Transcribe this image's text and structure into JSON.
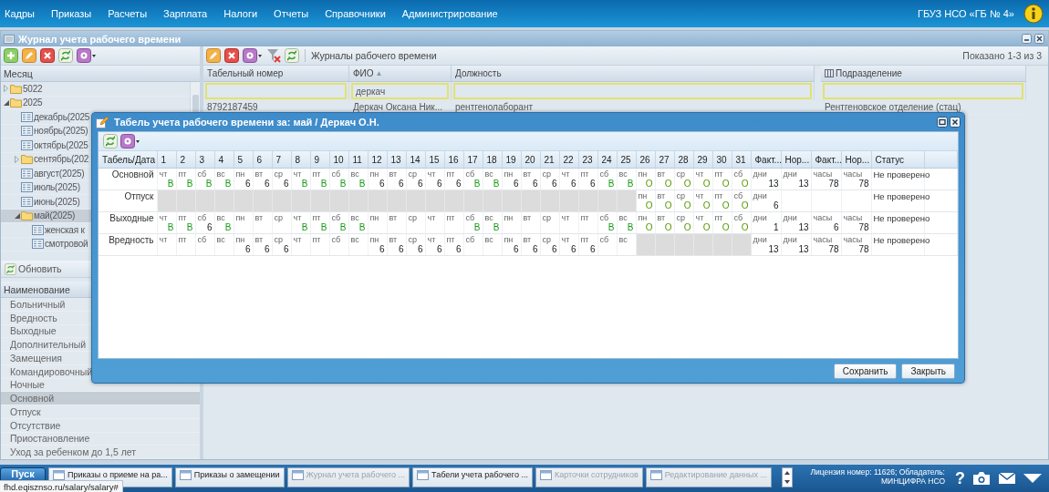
{
  "menu": {
    "items": [
      "Кадры",
      "Приказы",
      "Расчеты",
      "Зарплата",
      "Налоги",
      "Отчеты",
      "Справочники",
      "Администрирование"
    ],
    "organization": "ГБУЗ НСО «ГБ № 4»"
  },
  "journal": {
    "title": "Журнал учета рабочего времени",
    "month_tree": {
      "header": "Месяц",
      "items": [
        {
          "label": "5022",
          "kind": "folder",
          "expanded": false,
          "selected": false
        },
        {
          "label": "2025",
          "kind": "folder",
          "expanded": true,
          "selected": false,
          "children": [
            {
              "label": "декабрь(2025",
              "kind": "leaf",
              "selected": false
            },
            {
              "label": "ноябрь(2025)",
              "kind": "leaf",
              "selected": false
            },
            {
              "label": "октябрь(2025",
              "kind": "leaf",
              "selected": false
            },
            {
              "label": "сентябрь(202",
              "kind": "folder",
              "expanded": false,
              "selected": false
            },
            {
              "label": "август(2025)",
              "kind": "leaf",
              "selected": false
            },
            {
              "label": "июль(2025)",
              "kind": "leaf",
              "selected": false
            },
            {
              "label": "июнь(2025)",
              "kind": "leaf",
              "selected": false
            },
            {
              "label": "май(2025)",
              "kind": "folder",
              "expanded": true,
              "selected": true,
              "children": [
                {
                  "label": "женская к",
                  "kind": "leaf",
                  "selected": false
                },
                {
                  "label": "смотровой",
                  "kind": "leaf",
                  "selected": false
                }
              ]
            }
          ]
        }
      ]
    },
    "refresh_button": "Обновить",
    "types": {
      "header": "Наименование",
      "items": [
        {
          "label": "Больничный",
          "selected": false
        },
        {
          "label": "Вредность",
          "selected": false
        },
        {
          "label": "Выходные",
          "selected": false
        },
        {
          "label": "Дополнительный",
          "selected": false
        },
        {
          "label": "Замещения",
          "selected": false
        },
        {
          "label": "Командировочный",
          "selected": false
        },
        {
          "label": "Ночные",
          "selected": false
        },
        {
          "label": "Основной",
          "selected": true
        },
        {
          "label": "Отпуск",
          "selected": false
        },
        {
          "label": "Отсутствие",
          "selected": false
        },
        {
          "label": "Приостановление",
          "selected": false
        },
        {
          "label": "Уход за ребенком до 1,5 лет",
          "selected": false
        }
      ]
    },
    "grid": {
      "toolbar_title": "Журналы рабочего времени",
      "paging": "Показано 1-3 из 3",
      "columns": [
        {
          "label": "Табельный номер"
        },
        {
          "label": "ФИО",
          "sort_arrow": "▲",
          "filter": "деркач"
        },
        {
          "label": "Должность"
        },
        {
          "label": "Подразделение"
        }
      ],
      "rows": [
        {
          "cells": [
            "8792187459",
            "Деркач Оксана Ник...",
            "рентгенолаборант",
            "Рентгеновское отделение (стац)"
          ],
          "selected": false
        }
      ]
    }
  },
  "dialog": {
    "title": "Табель учета рабочего времени за: май / Деркач О.Н.",
    "columns": {
      "label": "Табель/Дата",
      "days": [
        "1",
        "2",
        "3",
        "4",
        "5",
        "6",
        "7",
        "8",
        "9",
        "10",
        "11",
        "12",
        "13",
        "14",
        "15",
        "16",
        "17",
        "18",
        "19",
        "20",
        "21",
        "22",
        "23",
        "24",
        "25",
        "26",
        "27",
        "28",
        "29",
        "30",
        "31"
      ],
      "totals": [
        "Факт...",
        "Нор...",
        "Факт...",
        "Нор..."
      ],
      "status": "Статус"
    },
    "rows": [
      {
        "label": "Основной",
        "days": [
          {
            "weekday": "чт",
            "kind": "off",
            "value": "В"
          },
          {
            "weekday": "пт",
            "kind": "off",
            "value": "В"
          },
          {
            "weekday": "сб",
            "kind": "off",
            "value": "В"
          },
          {
            "weekday": "вс",
            "kind": "off",
            "value": "В"
          },
          {
            "weekday": "пн",
            "kind": "hours",
            "value": "6"
          },
          {
            "weekday": "вт",
            "kind": "hours",
            "value": "6"
          },
          {
            "weekday": "ср",
            "kind": "hours",
            "value": "6"
          },
          {
            "weekday": "чт",
            "kind": "off",
            "value": "В"
          },
          {
            "weekday": "пт",
            "kind": "off",
            "value": "В"
          },
          {
            "weekday": "сб",
            "kind": "off",
            "value": "В"
          },
          {
            "weekday": "вс",
            "kind": "off",
            "value": "В"
          },
          {
            "weekday": "пн",
            "kind": "hours",
            "value": "6"
          },
          {
            "weekday": "вт",
            "kind": "hours",
            "value": "6"
          },
          {
            "weekday": "ср",
            "kind": "hours",
            "value": "6"
          },
          {
            "weekday": "чт",
            "kind": "hours",
            "value": "6"
          },
          {
            "weekday": "пт",
            "kind": "hours",
            "value": "6"
          },
          {
            "weekday": "сб",
            "kind": "off",
            "value": "В"
          },
          {
            "weekday": "вс",
            "kind": "off",
            "value": "В"
          },
          {
            "weekday": "пн",
            "kind": "hours",
            "value": "6"
          },
          {
            "weekday": "вт",
            "kind": "hours",
            "value": "6"
          },
          {
            "weekday": "ср",
            "kind": "hours",
            "value": "6"
          },
          {
            "weekday": "чт",
            "kind": "hours",
            "value": "6"
          },
          {
            "weekday": "пт",
            "kind": "hours",
            "value": "6"
          },
          {
            "weekday": "сб",
            "kind": "off",
            "value": "В"
          },
          {
            "weekday": "вс",
            "kind": "off",
            "value": "В"
          },
          {
            "weekday": "пн",
            "kind": "leave",
            "value": "О"
          },
          {
            "weekday": "вт",
            "kind": "leave",
            "value": "О"
          },
          {
            "weekday": "ср",
            "kind": "leave",
            "value": "О"
          },
          {
            "weekday": "чт",
            "kind": "leave",
            "value": "О"
          },
          {
            "weekday": "пт",
            "kind": "leave",
            "value": "О"
          },
          {
            "weekday": "сб",
            "kind": "leave",
            "value": "О"
          }
        ],
        "totals": [
          {
            "unit": "дни",
            "value": "13"
          },
          {
            "unit": "дни",
            "value": "13"
          },
          {
            "unit": "часы",
            "value": "78"
          },
          {
            "unit": "часы",
            "value": "78"
          }
        ],
        "status": "Не проверено"
      },
      {
        "label": "Отпуск",
        "days": [
          {
            "kind": "disabled"
          },
          {
            "kind": "disabled"
          },
          {
            "kind": "disabled"
          },
          {
            "kind": "disabled"
          },
          {
            "kind": "disabled"
          },
          {
            "kind": "disabled"
          },
          {
            "kind": "disabled"
          },
          {
            "kind": "disabled"
          },
          {
            "kind": "disabled"
          },
          {
            "kind": "disabled"
          },
          {
            "kind": "disabled"
          },
          {
            "kind": "disabled"
          },
          {
            "kind": "disabled"
          },
          {
            "kind": "disabled"
          },
          {
            "kind": "disabled"
          },
          {
            "kind": "disabled"
          },
          {
            "kind": "disabled"
          },
          {
            "kind": "disabled"
          },
          {
            "kind": "disabled"
          },
          {
            "kind": "disabled"
          },
          {
            "kind": "disabled"
          },
          {
            "kind": "disabled"
          },
          {
            "kind": "disabled"
          },
          {
            "kind": "disabled"
          },
          {
            "kind": "disabled"
          },
          {
            "weekday": "пн",
            "kind": "leave",
            "value": "О"
          },
          {
            "weekday": "вт",
            "kind": "leave",
            "value": "О"
          },
          {
            "weekday": "ср",
            "kind": "leave",
            "value": "О"
          },
          {
            "weekday": "чт",
            "kind": "leave",
            "value": "О"
          },
          {
            "weekday": "пт",
            "kind": "leave",
            "value": "О"
          },
          {
            "weekday": "сб",
            "kind": "leave",
            "value": "О"
          }
        ],
        "totals": [
          {
            "unit": "дни",
            "value": "6"
          }
        ],
        "status": "Не проверено"
      },
      {
        "label": "Выходные",
        "days": [
          {
            "weekday": "чт",
            "kind": "off",
            "value": "В"
          },
          {
            "weekday": "пт",
            "kind": "off",
            "value": "В"
          },
          {
            "weekday": "сб",
            "kind": "hours",
            "value": "6"
          },
          {
            "weekday": "вс",
            "kind": "off",
            "value": "В"
          },
          {
            "weekday": "пн",
            "kind": "empty"
          },
          {
            "weekday": "вт",
            "kind": "empty"
          },
          {
            "weekday": "ср",
            "kind": "empty"
          },
          {
            "weekday": "чт",
            "kind": "off",
            "value": "В"
          },
          {
            "weekday": "пт",
            "kind": "off",
            "value": "В"
          },
          {
            "weekday": "сб",
            "kind": "off",
            "value": "В"
          },
          {
            "weekday": "вс",
            "kind": "off",
            "value": "В"
          },
          {
            "weekday": "пн",
            "kind": "empty"
          },
          {
            "weekday": "вт",
            "kind": "empty"
          },
          {
            "weekday": "ср",
            "kind": "empty"
          },
          {
            "weekday": "чт",
            "kind": "empty"
          },
          {
            "weekday": "пт",
            "kind": "empty"
          },
          {
            "weekday": "сб",
            "kind": "off",
            "value": "В"
          },
          {
            "weekday": "вс",
            "kind": "off",
            "value": "В"
          },
          {
            "weekday": "пн",
            "kind": "empty"
          },
          {
            "weekday": "вт",
            "kind": "empty"
          },
          {
            "weekday": "ср",
            "kind": "empty"
          },
          {
            "weekday": "чт",
            "kind": "empty"
          },
          {
            "weekday": "пт",
            "kind": "empty"
          },
          {
            "weekday": "сб",
            "kind": "off",
            "value": "В"
          },
          {
            "weekday": "вс",
            "kind": "off",
            "value": "В"
          },
          {
            "weekday": "пн",
            "kind": "leave",
            "value": "О"
          },
          {
            "weekday": "вт",
            "kind": "leave",
            "value": "О"
          },
          {
            "weekday": "ср",
            "kind": "leave",
            "value": "О"
          },
          {
            "weekday": "чт",
            "kind": "leave",
            "value": "О"
          },
          {
            "weekday": "пт",
            "kind": "leave",
            "value": "О"
          },
          {
            "weekday": "сб",
            "kind": "leave",
            "value": "О"
          }
        ],
        "totals": [
          {
            "unit": "дни",
            "value": "1"
          },
          {
            "unit": "дни",
            "value": "13"
          },
          {
            "unit": "часы",
            "value": "6"
          },
          {
            "unit": "часы",
            "value": "78"
          }
        ],
        "status": "Не проверено"
      },
      {
        "label": "Вредность",
        "days": [
          {
            "weekday": "чт",
            "kind": "empty"
          },
          {
            "weekday": "пт",
            "kind": "empty"
          },
          {
            "weekday": "сб",
            "kind": "empty"
          },
          {
            "weekday": "вс",
            "kind": "empty"
          },
          {
            "weekday": "пн",
            "kind": "hours",
            "value": "6"
          },
          {
            "weekday": "вт",
            "kind": "hours",
            "value": "6"
          },
          {
            "weekday": "ср",
            "kind": "hours",
            "value": "6"
          },
          {
            "weekday": "чт",
            "kind": "empty"
          },
          {
            "weekday": "пт",
            "kind": "empty"
          },
          {
            "weekday": "сб",
            "kind": "empty"
          },
          {
            "weekday": "вс",
            "kind": "empty"
          },
          {
            "weekday": "пн",
            "kind": "hours",
            "value": "6"
          },
          {
            "weekday": "вт",
            "kind": "hours",
            "value": "6"
          },
          {
            "weekday": "ср",
            "kind": "hours",
            "value": "6"
          },
          {
            "weekday": "чт",
            "kind": "hours",
            "value": "6"
          },
          {
            "weekday": "пт",
            "kind": "hours",
            "value": "6"
          },
          {
            "weekday": "сб",
            "kind": "empty"
          },
          {
            "weekday": "вс",
            "kind": "empty"
          },
          {
            "weekday": "пн",
            "kind": "hours",
            "value": "6"
          },
          {
            "weekday": "вт",
            "kind": "hours",
            "value": "6"
          },
          {
            "weekday": "ср",
            "kind": "hours",
            "value": "6"
          },
          {
            "weekday": "чт",
            "kind": "hours",
            "value": "6"
          },
          {
            "weekday": "пт",
            "kind": "hours",
            "value": "6"
          },
          {
            "weekday": "сб",
            "kind": "empty"
          },
          {
            "weekday": "вс",
            "kind": "empty"
          },
          {
            "kind": "disabled"
          },
          {
            "kind": "disabled"
          },
          {
            "kind": "disabled"
          },
          {
            "kind": "disabled"
          },
          {
            "kind": "disabled"
          },
          {
            "kind": "disabled"
          }
        ],
        "totals": [
          {
            "unit": "дни",
            "value": "13"
          },
          {
            "unit": "дни",
            "value": "13"
          },
          {
            "unit": "часы",
            "value": "78"
          },
          {
            "unit": "часы",
            "value": "78"
          }
        ],
        "status": "Не проверено"
      }
    ],
    "buttons": [
      "Сохранить",
      "Закрыть"
    ]
  },
  "taskbar": {
    "start": "Пуск",
    "tasks": [
      {
        "label": "Приказы о приеме на ра...",
        "greyed": false
      },
      {
        "label": "Приказы о замещении",
        "greyed": false
      },
      {
        "label": "Журнал учета рабочего ...",
        "greyed": true
      },
      {
        "label": "Табели учета рабочего ...",
        "greyed": false
      },
      {
        "label": "Карточки сотрудников",
        "greyed": true
      },
      {
        "label": "Редактирование данных ...",
        "greyed": true
      }
    ],
    "license": [
      "Лицензия номер: 11626; Обладатель:",
      "МИНЦИФРА НСО"
    ],
    "help": "?"
  },
  "status_url": "fhd.eqisznso.ru/salary/salary#"
}
